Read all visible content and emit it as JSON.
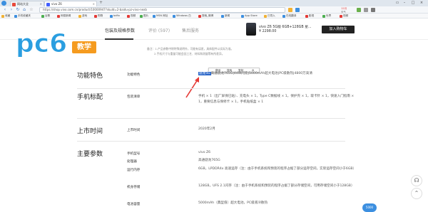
{
  "browser": {
    "tabs": [
      {
        "label": "网站大全"
      },
      {
        "label": "vivo Z6"
      }
    ],
    "url": "https://shop.vivo.com.cn/product/10000947?skuId=2-baidu-pz-vivo-nexb",
    "bookmarks": [
      "收藏",
      "手机收藏夹",
      "谷歌",
      "网易新闻",
      "游戏",
      "购物",
      "bdfix",
      "视频",
      "图片",
      "MSN 网址",
      "Windows 白",
      "搜索_微博",
      "新闻",
      "App Store",
      "已导入",
      "在线翻译",
      "影视",
      "世界",
      "视频"
    ],
    "right_info": {
      "label": "12月",
      "sub": "天气"
    }
  },
  "page": {
    "nav": {
      "tabs": [
        "包装及规格参数",
        "评价 (597)",
        "售后服务"
      ],
      "product_name": "vivo Z6 5G版 6GB+128GB 星...",
      "product_price": "¥ 2298.00",
      "buy_label": "加入购物车"
    },
    "notes": [
      "备注：1.产品参数中除特殊说明外，可能有误差，具体配件以实际为准。",
      "2.手机尺寸与重量可能会因工艺、材料和测量等有所差异。"
    ],
    "logo": {
      "text": "pc6",
      "badge": "教学"
    },
    "popup": {
      "items": [
        "翻译",
        "搜索",
        "复制",
        "⚙"
      ]
    },
    "sections": {
      "features": {
        "heading": "功能特色",
        "label": "功能特色",
        "highlight": "骁龙5G",
        "value": "高通骁龙765G|44W闪充|5000mAh超大电池|PC级散热|4800万高清",
        "value_line2": ""
      },
      "package": {
        "heading": "手机标配",
        "label": "包装清单",
        "value": "手机 × 1（出厂屏保已贴）、充电头 × 1，Type C数据线 × 1，保护壳 × 1，取卡针 × 1，快速入门指南 × 1，重要信息与保修卡 × 1，手机贴纸盒 × 1"
      },
      "launch": {
        "heading": "上市时间",
        "label": "上市时间",
        "value": "2020年2月"
      },
      "main": {
        "heading": "主要参数",
        "rows": [
          {
            "label": "手机型号",
            "value": "vivo Z6"
          },
          {
            "label": "处理器",
            "value": "高通骁龙765G"
          },
          {
            "label": "运行内存",
            "value": "6GB，LPDDR4x 高速运存（注：由于手机系统和预装的程序占据了部分运存空间，实际运存空间小于6GB）"
          },
          {
            "label": "机身存储",
            "value": "128GB，UFS 2.1闪存（注：由于手机系统和预装的程序占据了部分存储空间，可用存储空间小于128GB）"
          },
          {
            "label": "电池容量",
            "value": "5000mAh（典型值）超大电池，PC级液冷散热"
          }
        ]
      }
    },
    "float_button": "5000"
  },
  "colors": {
    "accent": "#2a9ee0",
    "badge": "#f59b1f",
    "arrow": "#e53935"
  }
}
